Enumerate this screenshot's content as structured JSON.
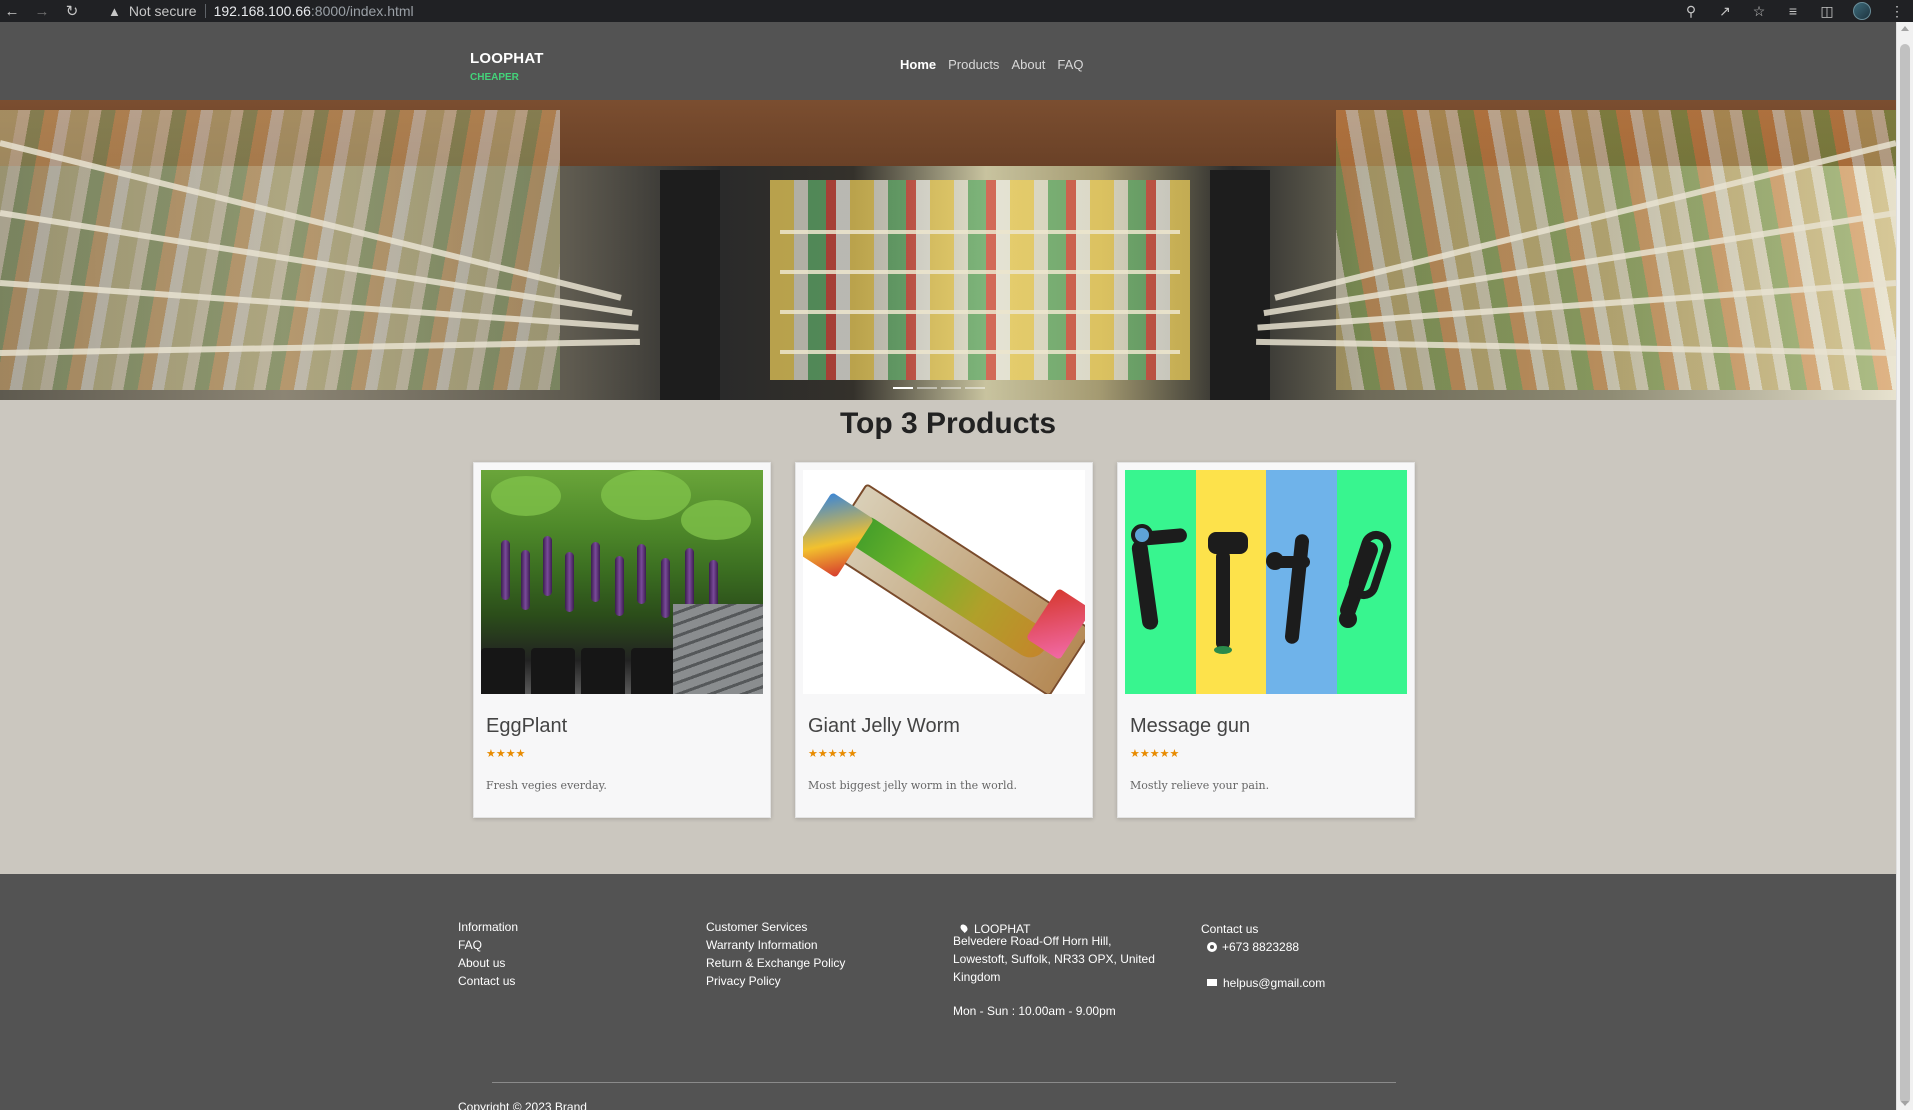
{
  "browser": {
    "security_label": "Not secure",
    "url_host": "192.168.100.66",
    "url_rest": ":8000/index.html"
  },
  "navbar": {
    "brand": "LOOPHAT",
    "tagline": "CHEAPER",
    "links": [
      {
        "label": "Home",
        "active": true
      },
      {
        "label": "Products",
        "active": false
      },
      {
        "label": "About",
        "active": false
      },
      {
        "label": "FAQ",
        "active": false
      }
    ]
  },
  "carousel": {
    "slide_count": 4,
    "active_index": 0
  },
  "products_section": {
    "title": "Top 3 Products",
    "items": [
      {
        "name": "EggPlant",
        "stars": "★★★★",
        "rating": 4,
        "description": "Fresh vegies everday."
      },
      {
        "name": "Giant Jelly Worm",
        "stars": "★★★★★",
        "rating": 5,
        "description": "Most biggest jelly worm in the world."
      },
      {
        "name": "Message gun",
        "stars": "★★★★★",
        "rating": 5,
        "description": "Mostly relieve your pain."
      }
    ]
  },
  "footer": {
    "information": {
      "heading": "Information",
      "links": [
        "FAQ",
        "About us",
        "Contact us"
      ]
    },
    "customer_services": {
      "heading": "Customer Services",
      "links": [
        "Warranty Information",
        "Return & Exchange Policy",
        "Privacy Policy"
      ]
    },
    "location": {
      "name": "LOOPHAT",
      "address": "Belvedere Road-Off Horn Hill, Lowestoft, Suffolk,  NR33 OPX, United Kingdom",
      "hours": "Mon - Sun : 10.00am - 9.00pm"
    },
    "contact": {
      "heading": "Contact us",
      "phone": "+673 8823288",
      "email": "helpus@gmail.com"
    },
    "copyright": "Copyright © 2023 Brand"
  },
  "colors": {
    "navbar_bg": "#535353",
    "page_bg": "#cbc7bf",
    "tagline": "#43d37a",
    "stars": "#e88b00",
    "gun_bands": [
      "#38f58f",
      "#fde24b",
      "#6fb3ea",
      "#38f58f"
    ]
  }
}
